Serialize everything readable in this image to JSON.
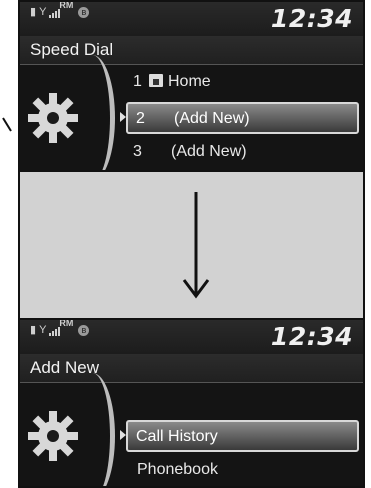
{
  "colors": {
    "screen_bg": "#1a1a1a",
    "highlight": "#8a8a8a",
    "text": "#f0f0f0",
    "gap_panel": "#d2d2d2"
  },
  "status": {
    "rm_label": "RM",
    "clock": "12:34"
  },
  "screen1": {
    "title": "Speed Dial",
    "items": [
      {
        "num": "1",
        "label": "Home",
        "icon": "home-icon",
        "highlighted": false
      },
      {
        "num": "2",
        "label": "(Add New)",
        "highlighted": true
      },
      {
        "num": "3",
        "label": "(Add New)",
        "highlighted": false
      }
    ]
  },
  "screen2": {
    "title": "Add New",
    "items": [
      {
        "label": "Call History",
        "highlighted": true
      },
      {
        "label": "Phonebook",
        "highlighted": false
      }
    ]
  }
}
